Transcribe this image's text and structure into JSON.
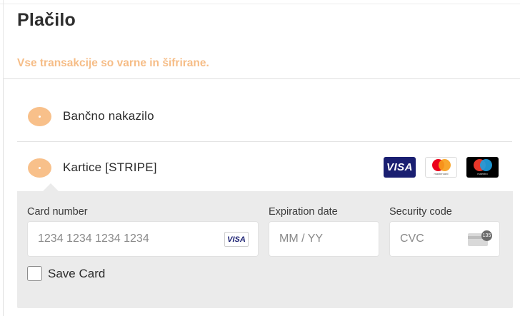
{
  "header": {
    "title": "Plačilo",
    "subtitle": "Vse transakcije so varne in šifrirane."
  },
  "payment_methods": [
    {
      "label": "Bančno nakazilo"
    },
    {
      "label": "Kartice [STRIPE]"
    }
  ],
  "card_logos": {
    "visa": "VISA",
    "mastercard": "mastercard",
    "maestro": "maestro"
  },
  "stripe_form": {
    "card_number": {
      "label": "Card number",
      "placeholder": "1234 1234 1234 1234",
      "brand": "VISA"
    },
    "expiration": {
      "label": "Expiration date",
      "placeholder": "MM / YY"
    },
    "security": {
      "label": "Security code",
      "placeholder": "CVC",
      "badge": "135"
    },
    "save_card": {
      "label": "Save Card",
      "checked": false
    }
  },
  "colors": {
    "accent": "#f8c08a",
    "subtitle": "#f6bd87",
    "form_bg": "#ebebeb",
    "visa_blue": "#1a1f71"
  }
}
